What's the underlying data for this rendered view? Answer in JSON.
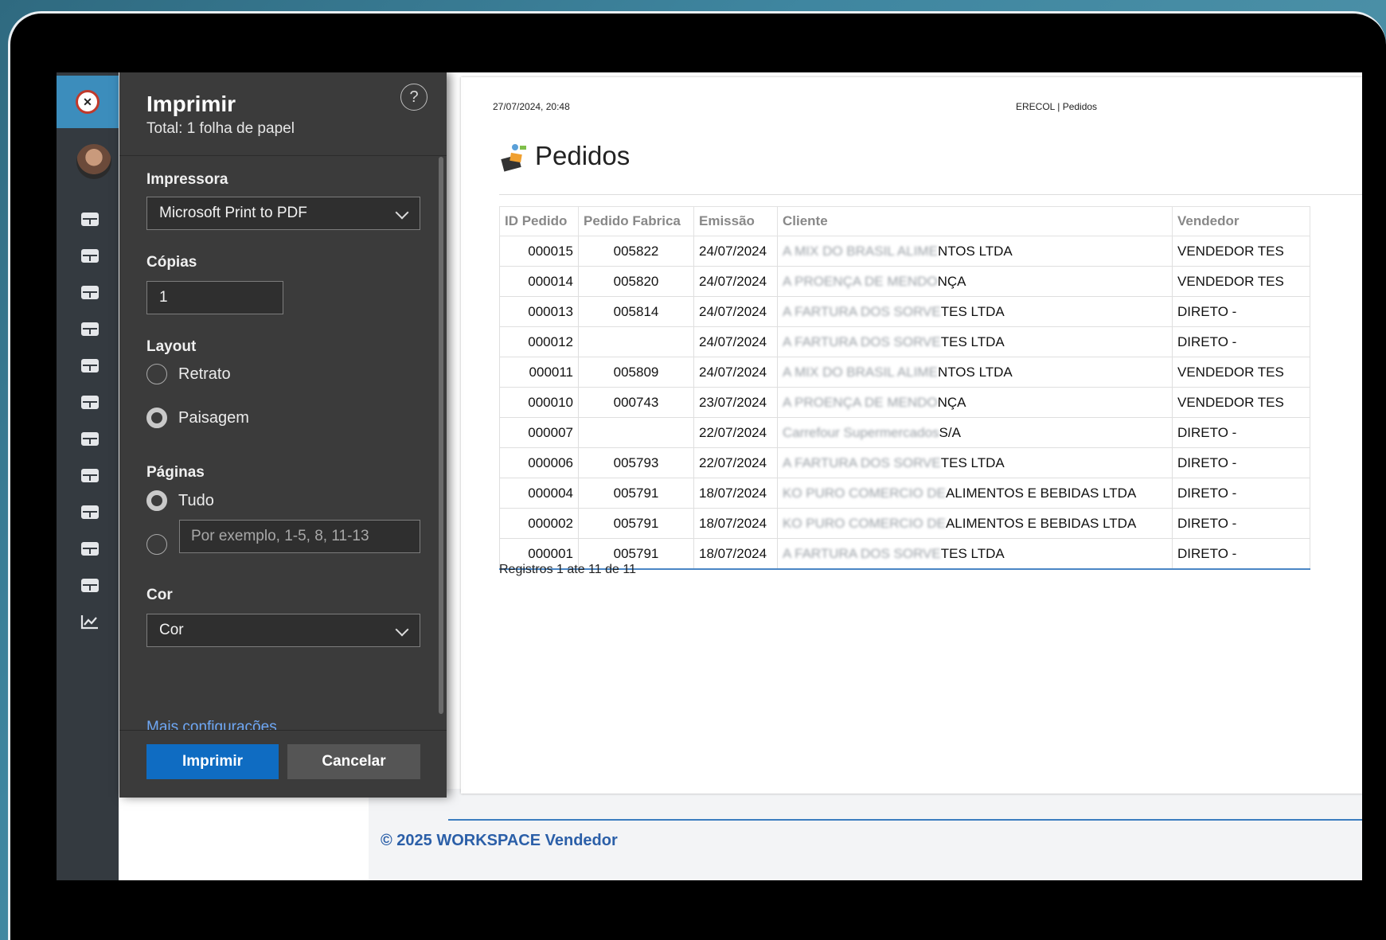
{
  "background_app": {
    "footer": "© 2025 WORKSPACE Vendedor",
    "sidebar_icons": [
      "table-icon",
      "table-icon",
      "table-icon",
      "table-icon",
      "table-icon",
      "table-icon",
      "table-icon",
      "table-icon",
      "table-icon",
      "table-icon",
      "table-icon",
      "chart-icon"
    ]
  },
  "print_dialog": {
    "title": "Imprimir",
    "subtitle": "Total: 1 folha de papel",
    "help": "?",
    "printer_label": "Impressora",
    "printer_value": "Microsoft Print to PDF",
    "copies_label": "Cópias",
    "copies_value": "1",
    "layout_label": "Layout",
    "layout_portrait": "Retrato",
    "layout_landscape": "Paisagem",
    "layout_selected": "Paisagem",
    "pages_label": "Páginas",
    "pages_all": "Tudo",
    "pages_placeholder": "Por exemplo, 1-5, 8, 11-13",
    "color_label": "Cor",
    "color_value": "Cor",
    "more_settings": "Mais configurações",
    "print_button": "Imprimir",
    "cancel_button": "Cancelar"
  },
  "preview": {
    "datetime": "27/07/2024, 20:48",
    "header": "ERECOL | Pedidos",
    "title": "Pedidos",
    "columns": [
      "ID Pedido",
      "Pedido Fabrica",
      "Emissão",
      "Cliente",
      "Vendedor"
    ],
    "rows": [
      {
        "id": "000015",
        "pf": "005822",
        "em": "24/07/2024",
        "cl_blur": "A MIX DO BRASIL ALIME",
        "cl": "NTOS LTDA",
        "vd": "VENDEDOR TES"
      },
      {
        "id": "000014",
        "pf": "005820",
        "em": "24/07/2024",
        "cl_blur": "A PROENÇA DE MENDO",
        "cl": "NÇA",
        "vd": "VENDEDOR TES"
      },
      {
        "id": "000013",
        "pf": "005814",
        "em": "24/07/2024",
        "cl_blur": "A FARTURA DOS SORVE",
        "cl": "TES LTDA",
        "vd": "DIRETO - "
      },
      {
        "id": "000012",
        "pf": "",
        "em": "24/07/2024",
        "cl_blur": "A FARTURA DOS SORVE",
        "cl": "TES LTDA",
        "vd": "DIRETO - "
      },
      {
        "id": "000011",
        "pf": "005809",
        "em": "24/07/2024",
        "cl_blur": "A MIX DO BRASIL ALIME",
        "cl": "NTOS LTDA",
        "vd": "VENDEDOR TES"
      },
      {
        "id": "000010",
        "pf": "000743",
        "em": "23/07/2024",
        "cl_blur": "A PROENÇA DE MENDO",
        "cl": "NÇA",
        "vd": "VENDEDOR TES"
      },
      {
        "id": "000007",
        "pf": "",
        "em": "22/07/2024",
        "cl_blur": "Carrefour Supermercados",
        "cl": "S/A",
        "vd": "DIRETO - "
      },
      {
        "id": "000006",
        "pf": "005793",
        "em": "22/07/2024",
        "cl_blur": "A FARTURA DOS SORVE",
        "cl": "TES LTDA",
        "vd": "DIRETO - "
      },
      {
        "id": "000004",
        "pf": "005791",
        "em": "18/07/2024",
        "cl_blur": "KO PURO COMERCIO DE",
        "cl": "ALIMENTOS E BEBIDAS LTDA",
        "vd": "DIRETO - "
      },
      {
        "id": "000002",
        "pf": "005791",
        "em": "18/07/2024",
        "cl_blur": "KO PURO COMERCIO DE",
        "cl": "ALIMENTOS E BEBIDAS LTDA",
        "vd": "DIRETO - "
      },
      {
        "id": "000001",
        "pf": "005791",
        "em": "18/07/2024",
        "cl_blur": "A FARTURA DOS SORVE",
        "cl": "TES LTDA",
        "vd": "DIRETO - "
      }
    ],
    "records": "Registros 1 ate 11 de 11"
  }
}
